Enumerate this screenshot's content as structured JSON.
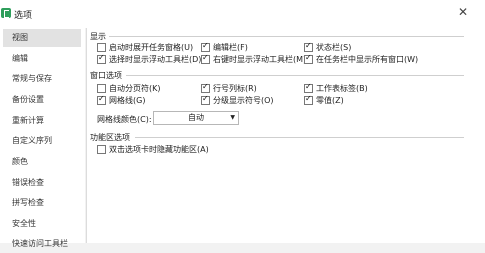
{
  "window": {
    "title": "选项"
  },
  "sidebar": {
    "items": [
      {
        "label": "视图"
      },
      {
        "label": "编辑"
      },
      {
        "label": "常规与保存"
      },
      {
        "label": "备份设置"
      },
      {
        "label": "重新计算"
      },
      {
        "label": "自定义序列"
      },
      {
        "label": "颜色"
      },
      {
        "label": "错误检查"
      },
      {
        "label": "拼写检查"
      },
      {
        "label": "安全性"
      },
      {
        "label": "快速访问工具栏"
      }
    ]
  },
  "display": {
    "title": "显示",
    "options": [
      {
        "label": "启动时展开任务窗格(U)",
        "checked": false
      },
      {
        "label": "编辑栏(F)",
        "checked": true
      },
      {
        "label": "状态栏(S)",
        "checked": true
      },
      {
        "label": "选择时显示浮动工具栏(D)",
        "checked": true
      },
      {
        "label": "右键时显示浮动工具栏(M)",
        "checked": true
      },
      {
        "label": "在任务栏中显示所有窗口(W)",
        "checked": true
      }
    ]
  },
  "window_options": {
    "title": "窗口选项",
    "options": [
      {
        "label": "自动分页符(K)",
        "checked": false
      },
      {
        "label": "行号列标(R)",
        "checked": true
      },
      {
        "label": "工作表标签(B)",
        "checked": true
      },
      {
        "label": "网格线(G)",
        "checked": true
      },
      {
        "label": "分级显示符号(O)",
        "checked": true
      },
      {
        "label": "零值(Z)",
        "checked": true
      }
    ],
    "gridline_color_label": "网格线颜色(C):",
    "gridline_color_value": "自动"
  },
  "ribbon": {
    "title": "功能区选项",
    "options": [
      {
        "label": "双击选项卡时隐藏功能区(A)",
        "checked": false
      }
    ]
  },
  "colors": {
    "brand": "#2e9e5b",
    "selected_bg": "#e2e2e2"
  }
}
